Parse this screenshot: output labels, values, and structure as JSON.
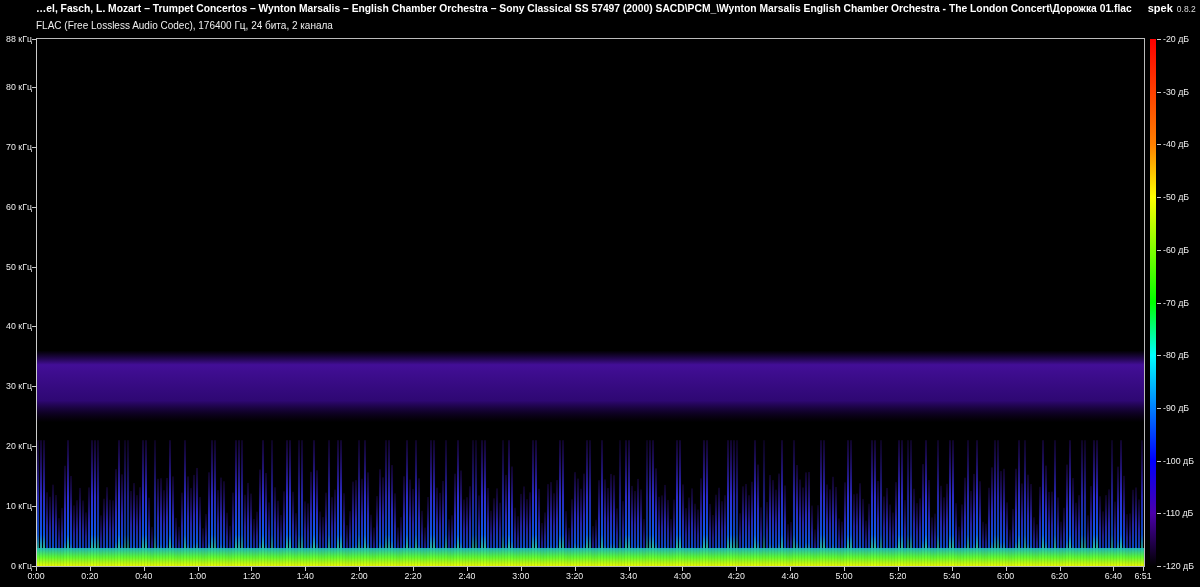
{
  "header": {
    "title": "…el, Fasch, L. Mozart – Trumpet Concertos – Wynton Marsalis – English Chamber Orchestra – Sony Classical SS 57497 (2000) SACD\\PCM_\\Wynton Marsalis English Chamber Orchestra - The London Concert\\Дорожка 01.flac",
    "app_name": "spek",
    "version": "0.8.2",
    "subtitle": "FLAC (Free Lossless Audio Codec), 176400 Гц, 24 бита, 2 канала"
  },
  "spectrogram": {
    "frequency_labels": [
      "88 кГц",
      "80 кГц",
      "70 кГц",
      "60 кГц",
      "50 кГц",
      "40 кГц",
      "30 кГц",
      "20 кГц",
      "10 кГц",
      "0 кГц"
    ],
    "time_labels": [
      "0:00",
      "0:20",
      "0:40",
      "1:00",
      "1:20",
      "1:40",
      "2:00",
      "2:20",
      "2:40",
      "3:00",
      "3:20",
      "3:40",
      "4:00",
      "4:20",
      "4:40",
      "5:00",
      "5:20",
      "5:40",
      "6:00",
      "6:20",
      "6:40",
      "6:51"
    ],
    "level_labels": [
      "-20 дБ",
      "-30 дБ",
      "-40 дБ",
      "-50 дБ",
      "-60 дБ",
      "-70 дБ",
      "-80 дБ",
      "-90 дБ",
      "-100 дБ",
      "-110 дБ",
      "-120 дБ"
    ]
  }
}
